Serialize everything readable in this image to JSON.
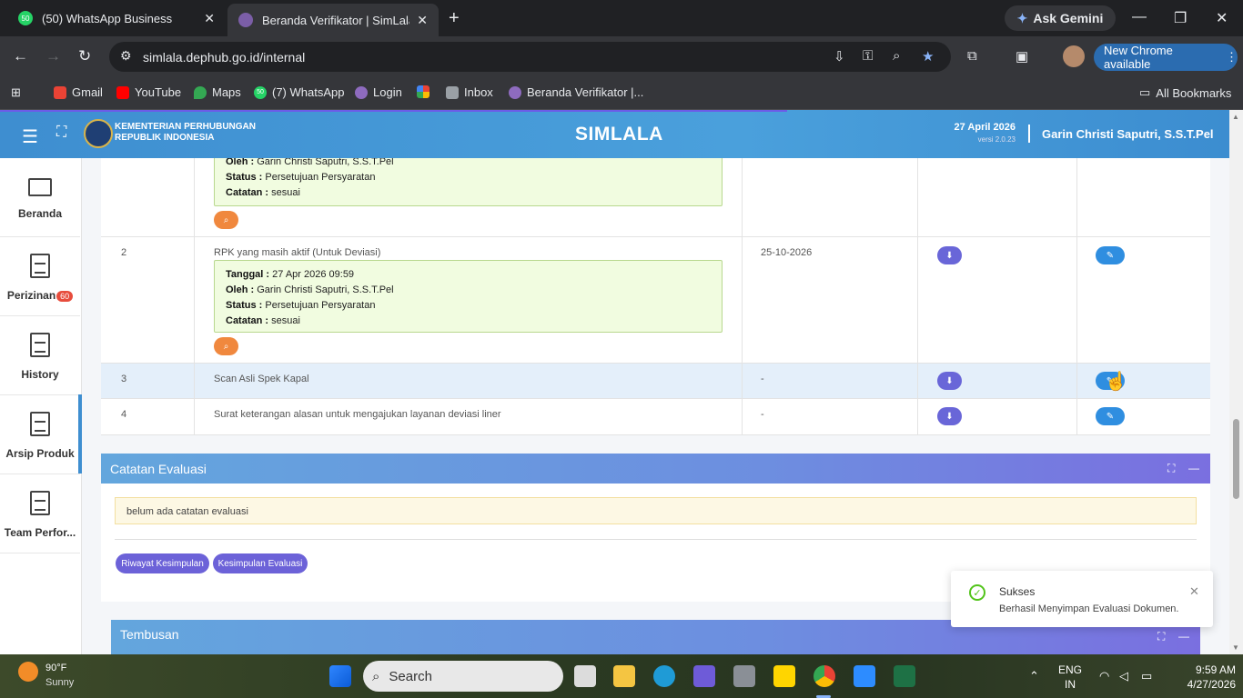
{
  "browser": {
    "tabs": [
      {
        "favicon_text": "50",
        "title": "(50) WhatsApp Business"
      },
      {
        "favicon_text": "",
        "title": "Beranda Verifikator | SimLala"
      }
    ],
    "ask_gemini": "Ask Gemini",
    "url": "simlala.dephub.go.id/internal",
    "new_chrome": "New Chrome available",
    "bookmarks": [
      {
        "label": "Gmail",
        "color": "#ea4335"
      },
      {
        "label": "YouTube",
        "color": "#ff0000"
      },
      {
        "label": "Maps",
        "color": "#34a853"
      },
      {
        "label": "(7) WhatsApp",
        "color": "#25d366"
      },
      {
        "label": "Login",
        "color": "#8e6bbf"
      },
      {
        "label": "",
        "color": "#fbbc05"
      },
      {
        "label": "Inbox",
        "color": "#9aa0a6"
      },
      {
        "label": "Beranda Verifikator |...",
        "color": "#8e6bbf"
      }
    ],
    "all_bookmarks": "All Bookmarks",
    "whatsapp_badge": "50"
  },
  "header": {
    "ministry_line1": "KEMENTERIAN PERHUBUNGAN",
    "ministry_line2": "REPUBLIK INDONESIA",
    "app_name": "SIMLALA",
    "date": "27 April 2026",
    "version": "versi 2.0.23",
    "user": "Garin Christi Saputri, S.S.T.Pel"
  },
  "sidebar": {
    "items": [
      {
        "label": "Beranda"
      },
      {
        "label": "Perizinan",
        "badge": "60"
      },
      {
        "label": "History"
      },
      {
        "label": "Arsip Produk"
      },
      {
        "label": "Team Perfor..."
      }
    ]
  },
  "table": {
    "rows": [
      {
        "no": "",
        "doc": "",
        "note": {
          "oleh": "Garin Christi Saputri, S.S.T.Pel",
          "status": "Persetujuan Persyaratan",
          "catatan": "sesuai"
        },
        "date": ""
      },
      {
        "no": "2",
        "doc": "RPK yang masih aktif (Untuk Deviasi)",
        "note": {
          "tanggal": "27 Apr 2026 09:59",
          "oleh": "Garin Christi Saputri, S.S.T.Pel",
          "status": "Persetujuan Persyaratan",
          "catatan": "sesuai"
        },
        "date": "25-10-2026"
      },
      {
        "no": "3",
        "doc": "Scan Asli Spek Kapal",
        "date": "-"
      },
      {
        "no": "4",
        "doc": "Surat keterangan alasan untuk mengajukan layanan deviasi liner",
        "date": "-"
      }
    ],
    "labels": {
      "tanggal": "Tanggal :",
      "oleh": "Oleh :",
      "status": "Status :",
      "catatan": "Catatan :"
    }
  },
  "evaluasi": {
    "title": "Catatan Evaluasi",
    "empty_note": "belum ada catatan evaluasi",
    "btn_riwayat": "Riwayat Kesimpulan",
    "btn_kesimpulan": "Kesimpulan Evaluasi"
  },
  "tembusan": {
    "title": "Tembusan"
  },
  "toast": {
    "title": "Sukses",
    "message": "Berhasil Menyimpan Evaluasi Dokumen."
  },
  "taskbar": {
    "temp": "90°F",
    "weather": "Sunny",
    "search_placeholder": "Search",
    "lang1": "ENG",
    "lang2": "IN",
    "time": "9:59 AM",
    "date": "4/27/2026"
  }
}
